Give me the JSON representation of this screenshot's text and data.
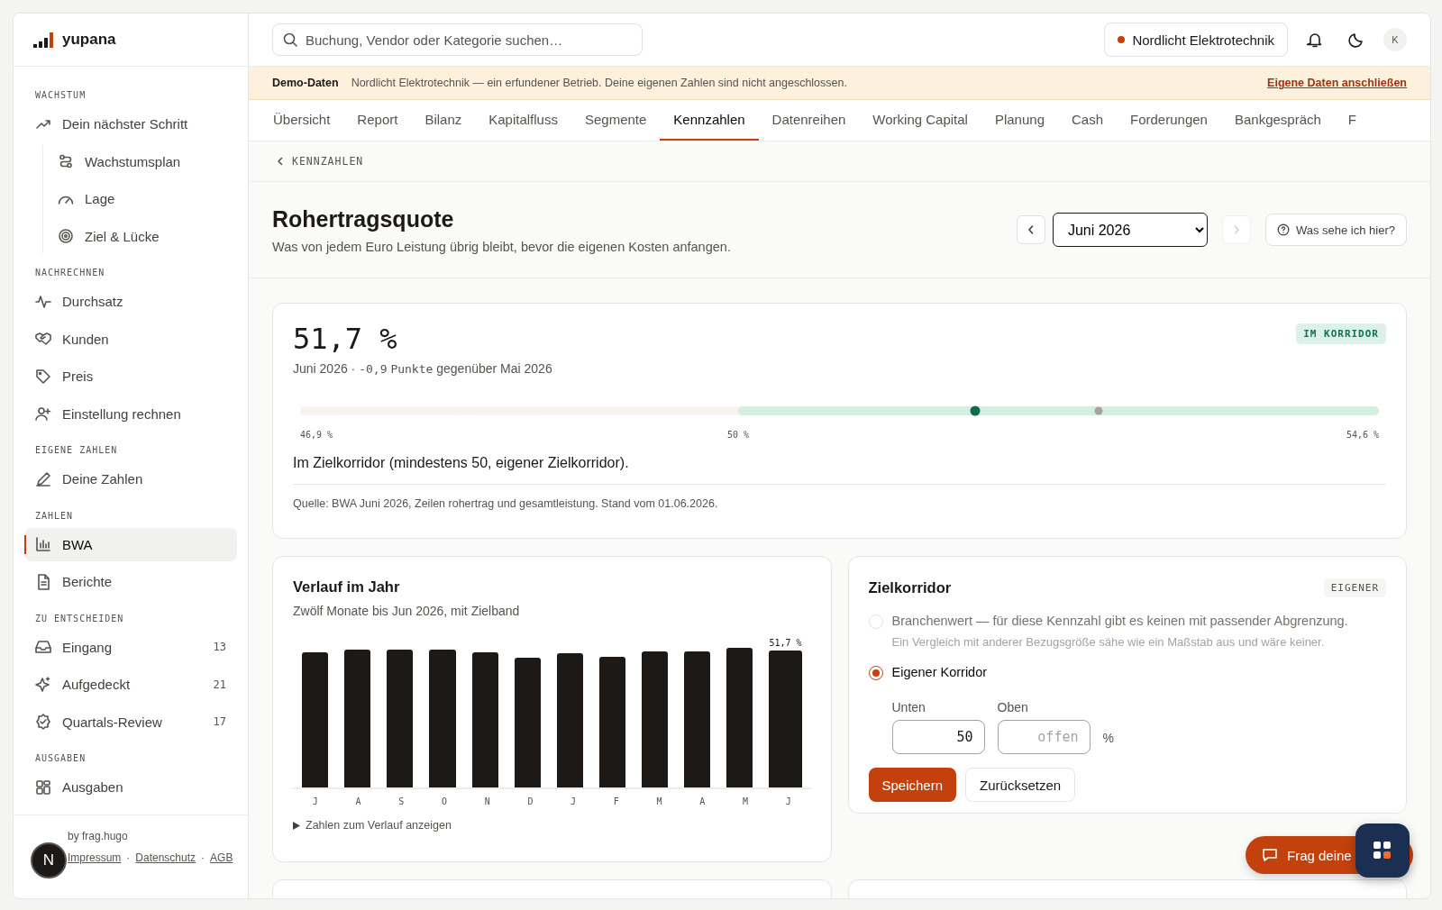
{
  "sidebar": {
    "logo": "yupana",
    "sections": [
      {
        "title": "WACHSTUM",
        "items": [
          {
            "label": "Dein nächster Schritt",
            "selected": false,
            "children": [
              {
                "label": "Wachstumsplan",
                "selected": false
              },
              {
                "label": "Lage",
                "selected": false
              },
              {
                "label": "Ziel & Lücke",
                "selected": false
              }
            ]
          }
        ]
      },
      {
        "title": "NACHRECHNEN",
        "items": [
          {
            "label": "Durchsatz",
            "selected": false
          },
          {
            "label": "Kunden",
            "selected": false
          },
          {
            "label": "Preis",
            "selected": false
          },
          {
            "label": "Einstellung rechnen",
            "selected": false
          }
        ]
      },
      {
        "title": "EIGENE ZAHLEN",
        "items": [
          {
            "label": "Deine Zahlen",
            "selected": false
          }
        ]
      },
      {
        "title": "ZAHLEN",
        "items": [
          {
            "label": "BWA",
            "selected": true
          },
          {
            "label": "Berichte",
            "selected": false
          }
        ]
      },
      {
        "title": "ZU ENTSCHEIDEN",
        "items": [
          {
            "label": "Eingang",
            "selected": false,
            "count": "13"
          },
          {
            "label": "Aufgedeckt",
            "selected": false,
            "count": "21"
          },
          {
            "label": "Quartals-Review",
            "selected": false,
            "count": "17"
          }
        ]
      },
      {
        "title": "AUSGABEN",
        "items": [
          {
            "label": "Ausgaben",
            "selected": false
          }
        ]
      }
    ],
    "footer": {
      "credit": "by frag.hugo",
      "links": [
        "Impressum",
        "Datenschutz",
        "AGB"
      ],
      "separator": "·"
    }
  },
  "topbar": {
    "search": {
      "placeholder": "Buchung, Vendor oder Kategorie suchen…"
    },
    "company": {
      "name": "Nordlicht Elektrotechnik",
      "color": "#c2410c"
    },
    "avatar": "K"
  },
  "banner": {
    "label": "Demo-Daten",
    "text": "Nordlicht Elektrotechnik — ein erfundener Betrieb. Deine eigenen Zahlen sind nicht angeschlossen.",
    "link": "Eigene Daten anschließen"
  },
  "tabs": [
    {
      "label": "Übersicht",
      "selected": false
    },
    {
      "label": "Report",
      "selected": false
    },
    {
      "label": "Bilanz",
      "selected": false
    },
    {
      "label": "Kapitalfluss",
      "selected": false
    },
    {
      "label": "Segmente",
      "selected": false
    },
    {
      "label": "Kennzahlen",
      "selected": true
    },
    {
      "label": "Datenreihen",
      "selected": false
    },
    {
      "label": "Working Capital",
      "selected": false
    },
    {
      "label": "Planung",
      "selected": false
    },
    {
      "label": "Cash",
      "selected": false
    },
    {
      "label": "Forderungen",
      "selected": false
    },
    {
      "label": "Bankgespräch",
      "selected": false
    },
    {
      "label": "F",
      "selected": false
    }
  ],
  "breadcrumb": "KENNZAHLEN",
  "page": {
    "title": "Rohertragsquote",
    "subtitle": "Was von jedem Euro Leistung übrig bleibt, bevor die eigenen Kosten anfangen.",
    "period": "Juni 2026",
    "prev_button": {
      "disabled": false
    },
    "next_button": {
      "disabled": true
    },
    "help": "Was sehe ich hier?"
  },
  "kpi": {
    "value": "51,7 %",
    "period": "Juni 2026",
    "separator": "·",
    "delta": "-0,9",
    "delta_text": "Punkte gegenüber Mai 2026",
    "badge": "IM KORRIDOR",
    "scale": {
      "min": "46,9 %",
      "mid": "50 %",
      "max": "54,6 %",
      "corridor": {
        "level": 0.594
      },
      "current": {
        "level": 0.626
      },
      "previous": {
        "level": 0.74
      }
    },
    "verdict": "Im Zielkorridor (mindestens 50, eigener Zielkorridor).",
    "source": "Quelle: BWA Juni 2026, Zeilen rohertrag und gesamtleistung. Stand vom 01.06.2026."
  },
  "trend": {
    "title": "Verlauf im Jahr",
    "subtitle": "Zwölf Monate bis Jun 2026, mit Zielband",
    "months": [
      {
        "label": "J"
      },
      {
        "label": "A"
      },
      {
        "label": "S"
      },
      {
        "label": "O"
      },
      {
        "label": "N"
      },
      {
        "label": "D"
      },
      {
        "label": "J"
      },
      {
        "label": "F"
      },
      {
        "label": "M"
      },
      {
        "label": "A"
      },
      {
        "label": "M"
      },
      {
        "label": "J",
        "value_label": "51,7 %"
      }
    ],
    "toggle": "Zahlen zum Verlauf anzeigen"
  },
  "corridor": {
    "title": "Zielkorridor",
    "badge": "EIGENER",
    "options": [
      {
        "label": "Branchenwert — für diese Kennzahl gibt es keinen mit passender Abgrenzung.",
        "hint": "Ein Vergleich mit anderer Bezugsgröße sähe wie ein Maßstab aus und wäre keiner.",
        "selected": false,
        "disabled": true
      },
      {
        "label": "Eigener Korridor",
        "selected": true,
        "disabled": false
      }
    ],
    "lower": {
      "label": "Unten",
      "value": "50"
    },
    "upper": {
      "label": "Oben",
      "placeholder": "offen"
    },
    "unit": "%",
    "save": "Speichern",
    "reset": "Zurücksetzen"
  },
  "chat": {
    "label": "Frag deine"
  },
  "dev_badge": "N"
}
